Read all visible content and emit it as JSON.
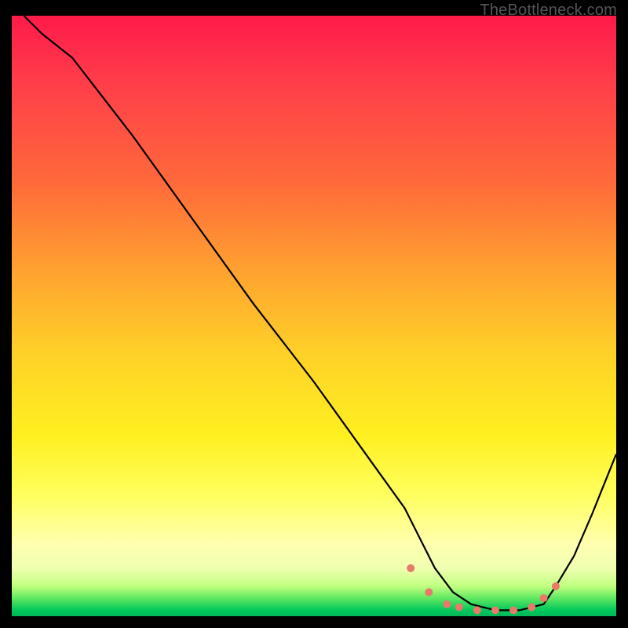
{
  "watermark": "TheBottleneck.com",
  "chart_data": {
    "type": "line",
    "title": "",
    "xlabel": "",
    "ylabel": "",
    "xlim": [
      0,
      100
    ],
    "ylim": [
      0,
      100
    ],
    "series": [
      {
        "name": "curve",
        "x": [
          2,
          5,
          10,
          20,
          30,
          40,
          50,
          60,
          65,
          68,
          70,
          73,
          76,
          80,
          84,
          88,
          90,
          93,
          96,
          100
        ],
        "y": [
          100,
          97,
          93,
          80,
          66,
          52,
          39,
          25,
          18,
          12,
          8,
          4,
          2,
          1,
          1,
          2,
          5,
          10,
          17,
          27
        ]
      }
    ],
    "markers": {
      "name": "dots",
      "color": "#e97a6a",
      "x": [
        66,
        69,
        72,
        74,
        77,
        80,
        83,
        86,
        88,
        90
      ],
      "y": [
        8,
        4,
        2,
        1.5,
        1,
        1,
        1,
        1.5,
        3,
        5
      ]
    },
    "gradient_stops": [
      {
        "pos": 0,
        "color": "#ff1a4a"
      },
      {
        "pos": 28,
        "color": "#ff6a3a"
      },
      {
        "pos": 56,
        "color": "#ffd028"
      },
      {
        "pos": 80,
        "color": "#ffff60"
      },
      {
        "pos": 95,
        "color": "#c0ff80"
      },
      {
        "pos": 100,
        "color": "#00b858"
      }
    ]
  }
}
